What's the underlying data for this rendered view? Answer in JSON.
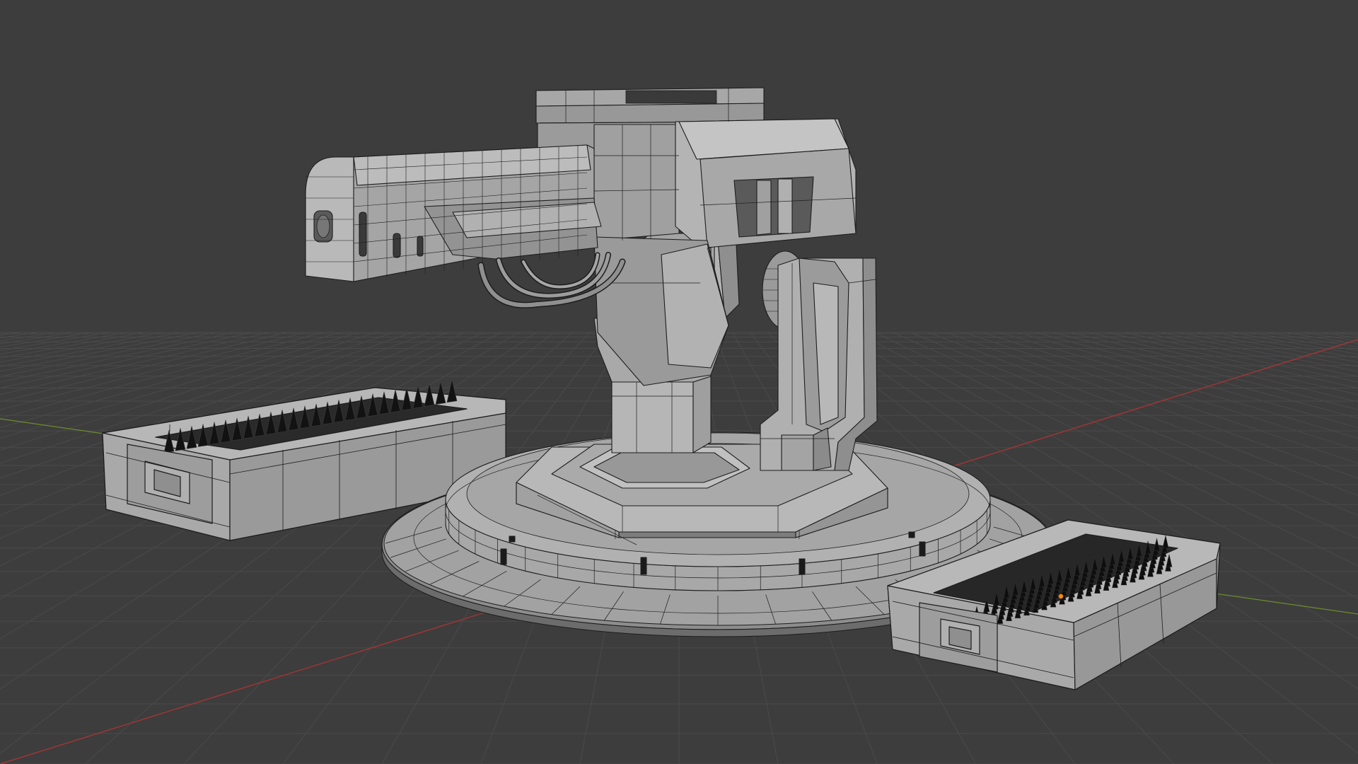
{
  "viewport": {
    "view": "3D Viewport",
    "shading": "solid",
    "overlay": "wireframe",
    "grid_floor": true,
    "axis_x_line": "red",
    "axis_y_line": "green",
    "object_origin_visible": true
  },
  "scene": {
    "objects": [
      {
        "name": "turret-base-disc"
      },
      {
        "name": "turret-pedestal"
      },
      {
        "name": "turret-support-arm-left"
      },
      {
        "name": "turret-support-arm-right"
      },
      {
        "name": "turret-gun-body"
      },
      {
        "name": "turret-barrel"
      },
      {
        "name": "turret-cables"
      },
      {
        "name": "spike-tray-left"
      },
      {
        "name": "spike-tray-right"
      }
    ]
  },
  "colors": {
    "background": "#3d3d3d",
    "grid_line": "#4a4a4a",
    "axis_x": "#a83434",
    "axis_y": "#6e8c2c",
    "mesh_fill": "#9c9c9c",
    "mesh_light": "#b3b3b3",
    "mesh_dark": "#7a7a7a",
    "wire": "#1d1d1d",
    "origin": "#ff8a00"
  }
}
